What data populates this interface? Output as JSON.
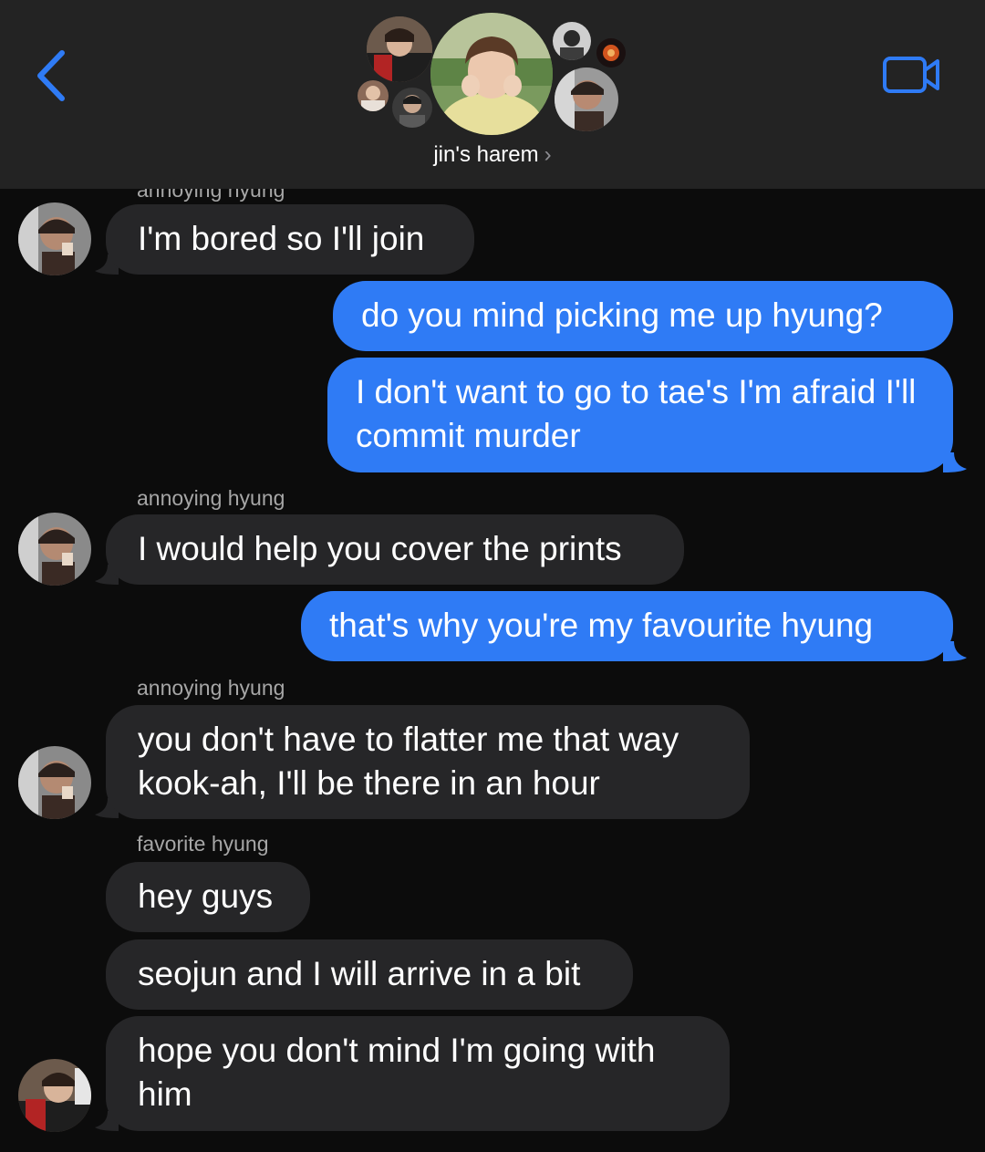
{
  "header": {
    "group_name": "jin's harem",
    "chevron": "›",
    "back_icon": "chevron-left-icon",
    "video_icon": "video-camera-icon",
    "accent_color": "#2f7bf5"
  },
  "messages": [
    {
      "type": "sender",
      "text": "annoying hyung"
    },
    {
      "type": "incoming",
      "text": "I'm bored so I'll join"
    },
    {
      "type": "outgoing",
      "text": "do you mind picking me up hyung?"
    },
    {
      "type": "outgoing",
      "text": "I don't want to go to tae's I'm afraid I'll commit murder"
    },
    {
      "type": "sender",
      "text": "annoying hyung"
    },
    {
      "type": "incoming",
      "text": "I would help you cover the prints"
    },
    {
      "type": "outgoing",
      "text": "that's why you're my favourite hyung"
    },
    {
      "type": "sender",
      "text": "annoying hyung"
    },
    {
      "type": "incoming",
      "text": "you don't have to flatter me that way kook-ah, I'll be there in an hour"
    },
    {
      "type": "sender",
      "text": "favorite hyung"
    },
    {
      "type": "incoming",
      "text": "hey guys"
    },
    {
      "type": "incoming",
      "text": "seojun and I will arrive in a bit"
    },
    {
      "type": "incoming",
      "text": "hope you don't mind I'm going with him"
    }
  ]
}
